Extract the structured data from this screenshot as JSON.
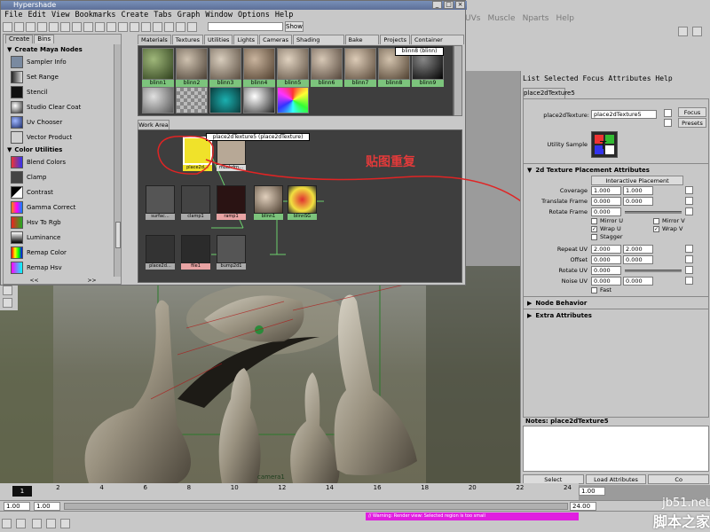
{
  "hypershade": {
    "title": "Hypershade",
    "menu": [
      "File",
      "Edit",
      "View",
      "Bookmarks",
      "Create",
      "Tabs",
      "Graph",
      "Window",
      "Options",
      "Help"
    ],
    "show_label": "Show",
    "left_tabs": [
      "Create",
      "Bins"
    ],
    "left_sections": [
      {
        "label": "Create Maya Nodes",
        "items": [
          "Sampler Info",
          "Set Range",
          "Stencil",
          "Studio Clear Coat",
          "Uv Chooser",
          "Vector Product"
        ]
      },
      {
        "label": "Color Utilities",
        "items": [
          "Blend Colors",
          "Clamp",
          "Contrast",
          "Gamma Correct",
          "Hsv To Rgb",
          "Luminance",
          "Remap Color",
          "Remap Hsv"
        ]
      }
    ],
    "left_nav": [
      "<<",
      ">>"
    ],
    "tabs": [
      "Materials",
      "Textures",
      "Utilities",
      "Lights",
      "Cameras",
      "Shading Groups",
      "Bake Sets",
      "Projects",
      "Container Nodes"
    ],
    "active_tab": "Materials",
    "materials": [
      "blinn1",
      "blinn2",
      "blinn3",
      "blinn4",
      "blinn5",
      "blinn6",
      "blinn7",
      "blinn8",
      "blinn9"
    ],
    "tooltip": "blinn8 (blinn)",
    "work_area_tab": "Work Area",
    "node_label": "place2dTexture5 (place2dTexture)",
    "nodes": [
      "place2d…",
      "mbakdrn…",
      "surfac…",
      "clamp1",
      "ramp1",
      "blinn1",
      "blinnSG",
      "place2d…",
      "file1",
      "bump2d1"
    ]
  },
  "maya_menu": [
    "UVs",
    "Muscle",
    "Nparts",
    "Help"
  ],
  "attribute_editor": {
    "menu": [
      "List",
      "Selected",
      "Focus",
      "Attributes",
      "Help"
    ],
    "tab": "place2dTexture5",
    "node_label": "place2dTexture:",
    "node_value": "place2dTexture5",
    "focus_label": "Focus",
    "presets_label": "Presets",
    "sample_label": "Utility Sample",
    "section_title": "2d Texture Placement Attributes",
    "interactive_placement": "Interactive Placement",
    "rows": [
      {
        "label": "Coverage",
        "a": "1.000",
        "b": "1.000"
      },
      {
        "label": "Translate Frame",
        "a": "0.000",
        "b": "0.000"
      },
      {
        "label": "Rotate Frame",
        "a": "0.000",
        "b": ""
      }
    ],
    "checks": [
      {
        "label": "Mirror U",
        "checked": false
      },
      {
        "label": "Mirror V",
        "checked": false
      },
      {
        "label": "Wrap U",
        "checked": true
      },
      {
        "label": "Wrap V",
        "checked": true
      },
      {
        "label": "Stagger",
        "checked": false
      }
    ],
    "rows2": [
      {
        "label": "Repeat UV",
        "a": "2.000",
        "b": "2.000"
      },
      {
        "label": "Offset",
        "a": "0.000",
        "b": "0.000"
      },
      {
        "label": "Rotate UV",
        "a": "0.000",
        "b": ""
      },
      {
        "label": "Noise UV",
        "a": "0.000",
        "b": "0.000"
      }
    ],
    "fast_label": "Fast",
    "collapsed": [
      "Node Behavior",
      "Extra Attributes"
    ],
    "notes_label": "Notes:  place2dTexture5",
    "bottom_buttons": [
      "Select",
      "Load Attributes",
      "Co"
    ]
  },
  "annotation": "贴图重复",
  "timeline": {
    "ticks": [
      "1",
      "2",
      "4",
      "6",
      "8",
      "10",
      "12",
      "14",
      "16",
      "18",
      "20",
      "22",
      "24"
    ],
    "current": "1",
    "start": "1.00",
    "start2": "1.00",
    "end": "24.00",
    "end2": "1.00",
    "warning": "// Warning: Render view: Selected region is too small"
  },
  "watermark": {
    "line1": "jb51.net",
    "line2": "脚本之家"
  },
  "viewport": {
    "camera_label": "camera1"
  }
}
